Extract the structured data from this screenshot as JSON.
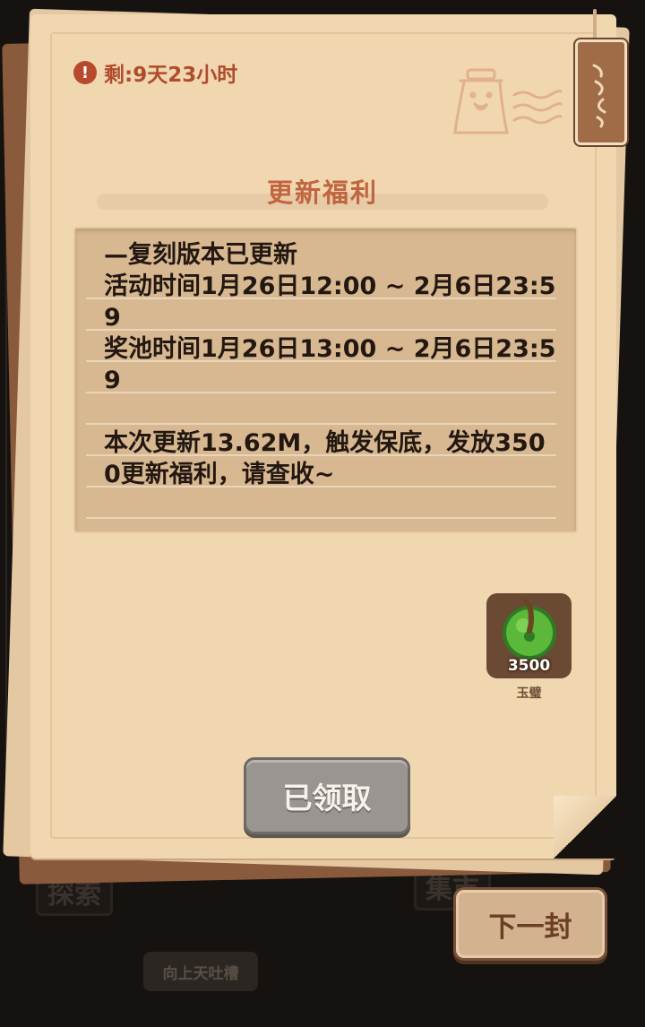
{
  "timer": {
    "icon": "alert-icon",
    "text": "剩:9天23小时"
  },
  "letter": {
    "title": "更新福利",
    "body": "—复刻版本已更新\n活动时间1月26日12:00 ~ 2月6日23:59\n奖池时间1月26日13:00 ~ 2月6日23:59\n\n本次更新13.62M，触发保底，发放3500更新福利，请查收~"
  },
  "reward": {
    "icon": "jade-disc-icon",
    "count": "3500",
    "name": "玉璧"
  },
  "buttons": {
    "claimed": "已领取",
    "next": "下一封"
  },
  "background": {
    "labels": [
      "探索",
      "集市"
    ],
    "sign": "向上天吐槽"
  },
  "colors": {
    "paper": "#f1d7b0",
    "title": "#c06540",
    "accent": "#b04c2e"
  }
}
